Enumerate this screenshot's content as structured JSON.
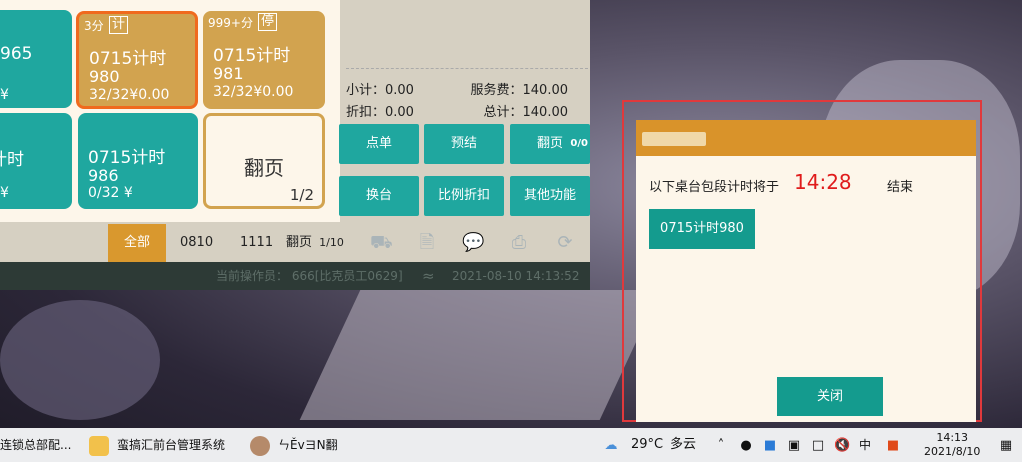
{
  "tiles": [
    {
      "name": "",
      "num": "965",
      "sub": "¥"
    },
    {
      "tag": "3分",
      "tagbox": "计",
      "name": "0715计时",
      "num": "980",
      "sub": "32/32¥0.00"
    },
    {
      "tag": "999+分",
      "tagbox": "停",
      "name": "0715计时",
      "num": "981",
      "sub": "32/32¥0.00"
    },
    {
      "name": "计时",
      "num": "",
      "sub": "¥"
    },
    {
      "name": "0715计时",
      "num": "986",
      "sub": "0/32  ¥"
    }
  ],
  "page_tile": {
    "label": "翻页",
    "page": "1/2"
  },
  "summary": {
    "subtotal": "小计：0.00",
    "service_fee": "服务费：140.00",
    "discount": "折扣：0.00",
    "total": "总计：140.00"
  },
  "actions": {
    "order": "点单",
    "prepay": "预结",
    "page": "翻页",
    "page_count": "0/0",
    "change_table": "换台",
    "ratio_discount": "比例折扣",
    "other": "其他功能"
  },
  "filter": {
    "all": "全部",
    "area1": "0810",
    "area2": "1111",
    "page_label": "翻页",
    "page_num": "1/10"
  },
  "status": {
    "operator": "当前操作员：  666[比克员工0629]",
    "datetime": "2021-08-10 14:13:52"
  },
  "dialog": {
    "message": "以下桌台包段计时将于",
    "time": "14:28",
    "end": "结束",
    "table": "0715计时980",
    "close": "关闭"
  },
  "taskbar": {
    "item1": "连锁总部配...",
    "item2": "蛮搞汇前台管理系统",
    "item3": "ㄣĚvヨΝ翻",
    "weather_temp": "29°C",
    "weather_desc": "多云",
    "ime": "中",
    "time": "14:13",
    "date": "2021/8/10"
  },
  "colors": {
    "teal": "#1fa79f",
    "gold": "#d2a34f",
    "orange": "#d9932a",
    "alert_red": "#e01b1b"
  }
}
